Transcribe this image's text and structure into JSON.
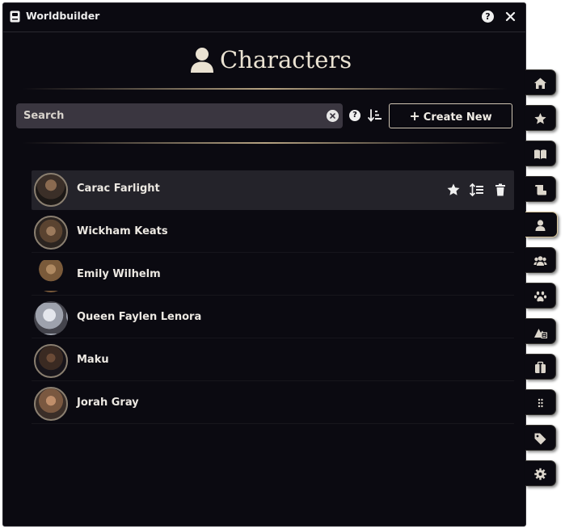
{
  "window": {
    "title": "Worldbuilder",
    "help": "?"
  },
  "page": {
    "title": "Characters"
  },
  "search": {
    "placeholder": "Search",
    "value": "",
    "help": "?"
  },
  "toolbar": {
    "create_label": "Create New"
  },
  "characters": [
    {
      "name": "Carac Farlight",
      "selected": true
    },
    {
      "name": "Wickham Keats"
    },
    {
      "name": "Emily Wilhelm"
    },
    {
      "name": "Queen Faylen Lenora"
    },
    {
      "name": "Maku"
    },
    {
      "name": "Jorah Gray"
    }
  ],
  "row_actions": [
    "star-icon",
    "reorder-icon",
    "trash-icon"
  ],
  "sidebar": {
    "tabs": [
      {
        "icon": "home-icon"
      },
      {
        "icon": "star-icon"
      },
      {
        "icon": "book-icon"
      },
      {
        "icon": "scroll-icon"
      },
      {
        "icon": "character-icon",
        "active": true
      },
      {
        "icon": "group-icon"
      },
      {
        "icon": "paw-icon"
      },
      {
        "icon": "locations-icon"
      },
      {
        "icon": "items-icon"
      },
      {
        "icon": "grip-icon"
      },
      {
        "icon": "tag-icon"
      },
      {
        "icon": "settings-icon"
      }
    ]
  },
  "colors": {
    "background": "#0b0a11",
    "accent": "#d8c59a",
    "text": "#ece8e2",
    "selected_row": "#24232a"
  }
}
